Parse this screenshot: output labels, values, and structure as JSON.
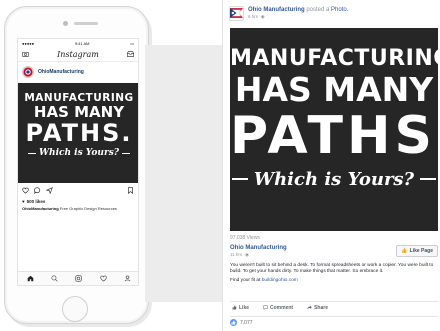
{
  "instagram": {
    "app_title": "Instagram",
    "status_time": "9:41 AM",
    "username": "OhioManufacturing",
    "likes": "500 likes",
    "caption_user": "OhioManufacturing",
    "caption_text": "Free Graphic Design Resources",
    "icons": [
      "camera-icon",
      "inbox-icon",
      "heart-icon",
      "comment-icon",
      "share-icon",
      "bookmark-icon",
      "home-icon",
      "search-icon",
      "add-icon",
      "activity-icon",
      "profile-icon"
    ]
  },
  "poster": {
    "line1": "MANUFACTURING",
    "line2": "HAS MANY",
    "line3": "PATHS.",
    "tagline": "Which is Yours?",
    "background_color": "#262626",
    "text_color": "#ffffff"
  },
  "facebook": {
    "page_name": "Ohio Manufacturing",
    "posted_text": "posted a",
    "photo_link": "Photo.",
    "time": "6 hrs",
    "views": "97,038 Views",
    "page_title": "Ohio Manufacturing",
    "page_time": "11 hrs",
    "like_page": "Like Page",
    "body": "You weren't built to sit behind a desk. To format spreadsheets or work a copier. You were built to build. To get your hands dirty. To make things that matter. So embrace it.",
    "find_text": "Find your fit at",
    "find_link": "buildingohio.com",
    "like": "Like",
    "comment": "Comment",
    "share": "Share",
    "reactions": "7,077",
    "link_color": "#365899"
  }
}
